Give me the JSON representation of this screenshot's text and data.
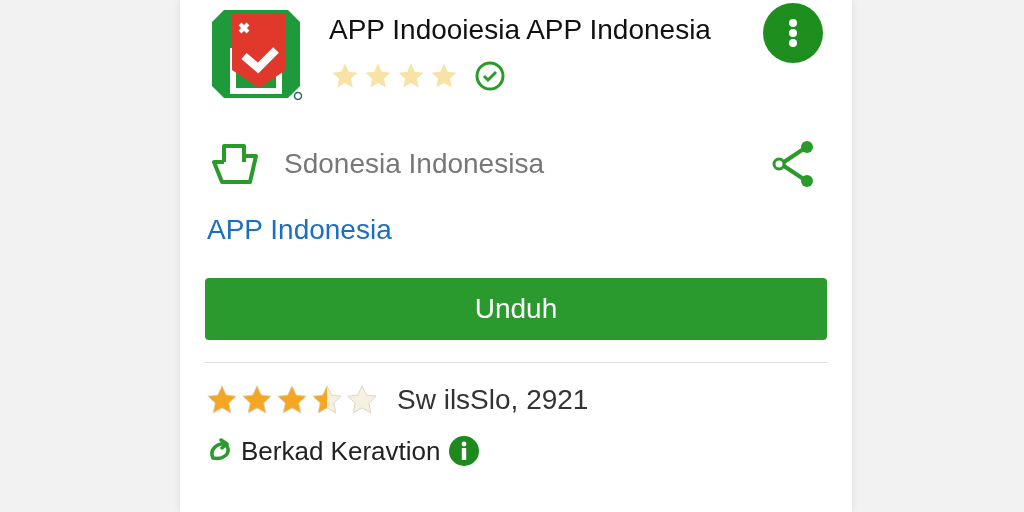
{
  "app": {
    "title": "APP Indooiesia APP Indonesia",
    "stars": 4,
    "verified": true
  },
  "developer": {
    "name": "Sdonesia Indonesisa"
  },
  "link": "APP Indonesia",
  "download_button": "Unduh",
  "rating": {
    "stars": 3.5,
    "text": "Sw ilsSlo, 2921"
  },
  "feature": {
    "text": "Berkad Keravtion"
  }
}
